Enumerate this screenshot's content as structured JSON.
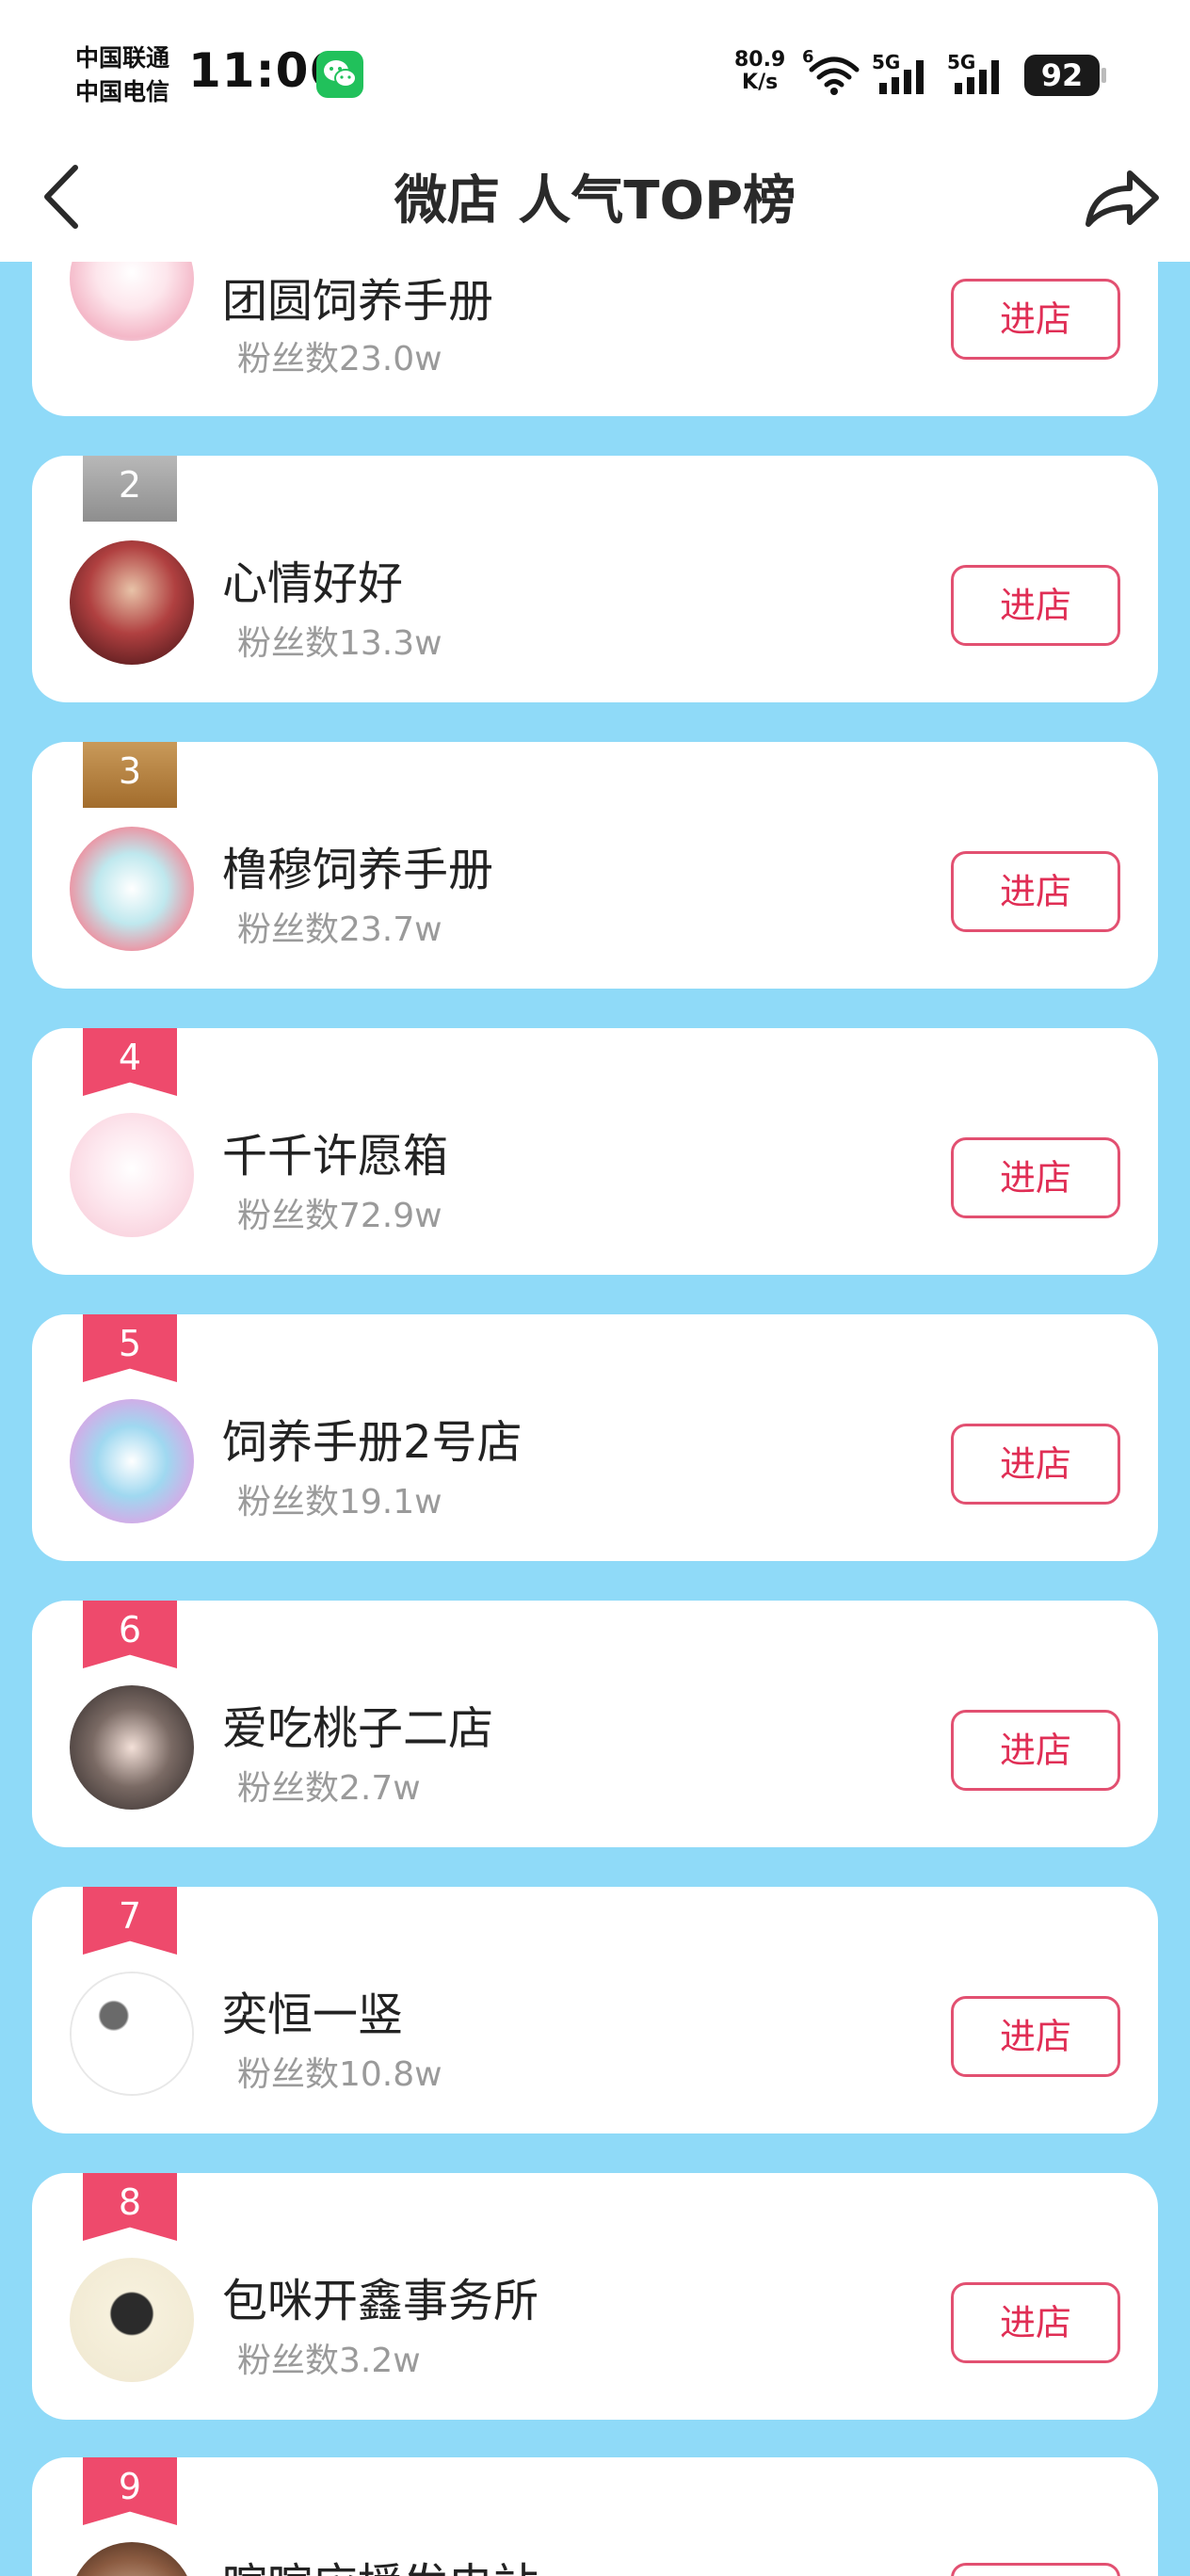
{
  "status_bar": {
    "carrier_1": "中国联通",
    "carrier_2": "中国电信",
    "time": "11:06",
    "net_speed_value": "80.9",
    "net_speed_unit": "K/s",
    "wifi_badge": "6",
    "sim1_label": "5G",
    "sim2_label": "5G",
    "battery": "92"
  },
  "header": {
    "title": "微店 人气TOP榜",
    "back_icon": "chevron-left-icon",
    "share_icon": "share-arrow-icon"
  },
  "enter_label": "进店",
  "shops": [
    {
      "rank": "",
      "name": "团圆饲养手册",
      "fans": "粉丝数23.0w",
      "avatar_color": "#f7cfd9"
    },
    {
      "rank": "2",
      "name": "心情好好",
      "fans": "粉丝数13.3w",
      "avatar_color": "#7a1c1c"
    },
    {
      "rank": "3",
      "name": "橹穆饲养手册",
      "fans": "粉丝数23.7w",
      "avatar_color": "#f4a9b5"
    },
    {
      "rank": "4",
      "name": "千千许愿箱",
      "fans": "粉丝数72.9w",
      "avatar_color": "#fbd3de"
    },
    {
      "rank": "5",
      "name": "饲养手册2号店",
      "fans": "粉丝数19.1w",
      "avatar_color": "#c9b8e8"
    },
    {
      "rank": "6",
      "name": "爱吃桃子二店",
      "fans": "粉丝数2.7w",
      "avatar_color": "#5b4a44"
    },
    {
      "rank": "7",
      "name": "奕恒一竖",
      "fans": "粉丝数10.8w",
      "avatar_color": "#e6e6e6"
    },
    {
      "rank": "8",
      "name": "包咪开鑫事务所",
      "fans": "粉丝数3.2w",
      "avatar_color": "#f3ecd7"
    },
    {
      "rank": "9",
      "name": "喧喧应援发电站",
      "fans": "",
      "avatar_color": "#d9b89a"
    }
  ]
}
